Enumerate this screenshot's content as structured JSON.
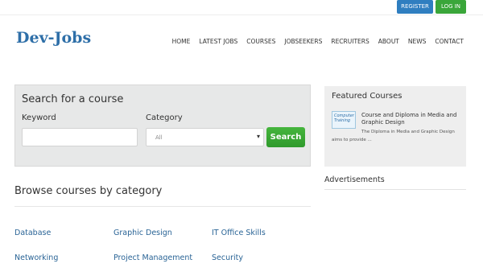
{
  "header": {
    "register_label": "REGISTER",
    "login_label": "LOG IN",
    "logo": "Dev-Jobs",
    "nav": [
      "HOME",
      "LATEST JOBS",
      "COURSES",
      "JOBSEEKERS",
      "RECRUITERS",
      "ABOUT",
      "NEWS",
      "CONTACT"
    ]
  },
  "search": {
    "title": "Search for a course",
    "keyword_label": "Keyword",
    "keyword_value": "",
    "category_label": "Category",
    "category_selected": "All",
    "button_label": "Search"
  },
  "browse": {
    "title": "Browse courses by category",
    "categories": [
      "Database",
      "Graphic Design",
      "IT Office Skills",
      "Networking",
      "Project Management",
      "Security"
    ]
  },
  "featured": {
    "title": "Featured Courses",
    "course_title": "Course and Diploma in Media and Graphic Design",
    "course_desc": "The Diploma in Media and Graphic Design aims to provide ...",
    "thumb_text": "Computer Training"
  },
  "ads": {
    "title": "Advertisements"
  },
  "colors": {
    "brand_blue": "#2e6fa8",
    "register_blue": "#2f7ec0",
    "green": "#3aa63a",
    "link_blue": "#2a6496"
  }
}
